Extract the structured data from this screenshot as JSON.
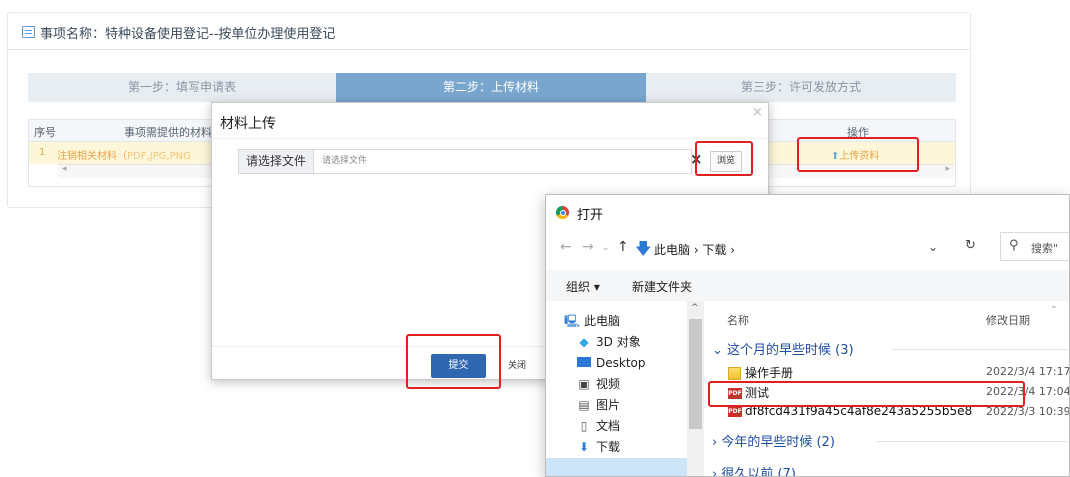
{
  "page": {
    "title": "事项名称：特种设备使用登记--按单位办理使用登记"
  },
  "steps": [
    {
      "label": "第一步：填写申请表"
    },
    {
      "label": "第二步：上传材料"
    },
    {
      "label": "第三步：许可发放方式"
    }
  ],
  "table": {
    "headers": {
      "index": "序号",
      "material": "事项需提供的材料",
      "operation": "操作"
    },
    "rows": [
      {
        "index": "1",
        "material": "注销相关材料（",
        "material_hint": "PDF,JPG,PNG",
        "operation": "上传资料"
      }
    ]
  },
  "modal": {
    "title": "材料上传",
    "close_icon": "×",
    "file_label": "请选择文件",
    "file_placeholder": "请选择文件",
    "clear_icon": "×",
    "browse_label": "浏览",
    "submit_label": "提交",
    "close_label": "关闭"
  },
  "dialog": {
    "title": "打开",
    "breadcrumb": "此电脑 › 下载 ›",
    "search_placeholder": "搜索\"",
    "organize_label": "组织 ▾",
    "new_folder_label": "新建文件夹",
    "tree": [
      "此电脑",
      "3D 对象",
      "Desktop",
      "视频",
      "图片",
      "文档",
      "下载"
    ],
    "columns": {
      "name": "名称",
      "date": "修改日期"
    },
    "groups": [
      {
        "label": "这个月的早些时候 (3)"
      },
      {
        "label": "今年的早些时候 (2)"
      },
      {
        "label": "很久以前 (7)"
      }
    ],
    "files": [
      {
        "name": "操作手册",
        "date": "2022/3/4 17:17",
        "type": "folder"
      },
      {
        "name": "测试",
        "date": "2022/3/4 17:04",
        "type": "pdf"
      },
      {
        "name": "df8fcd431f9a45c4af8e243a5255b5e8",
        "date": "2022/3/3 10:39",
        "type": "pdf"
      }
    ]
  },
  "colors": {
    "active_step": "#79a6cf",
    "highlight_red": "#e02020",
    "submit_blue": "#2f67b1",
    "row_highlight": "#fdf6d8"
  }
}
